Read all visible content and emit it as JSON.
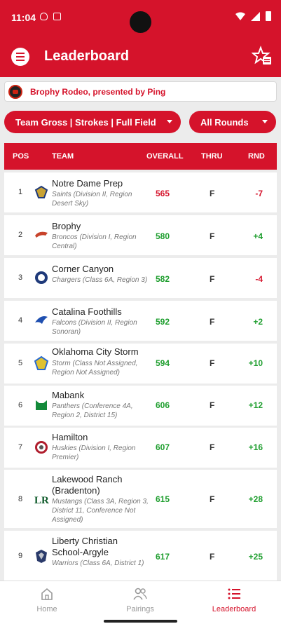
{
  "status": {
    "time": "11:04"
  },
  "app_bar": {
    "title": "Leaderboard"
  },
  "event": {
    "name": "Brophy Rodeo, presented by Ping"
  },
  "filters": {
    "main": "Team Gross | Strokes | Full Field",
    "rounds": "All Rounds"
  },
  "table": {
    "headers": {
      "pos": "POS",
      "team": "TEAM",
      "overall": "OVERALL",
      "thru": "THRU",
      "rnd": "RND"
    },
    "rows": [
      {
        "pos": "1",
        "name": "Notre Dame Prep",
        "sub": "Saints (Division II, Region Desert Sky)",
        "overall": "565",
        "thru": "F",
        "rnd": "-7",
        "overall_color": "#d5132b",
        "rnd_color": "#d5132b"
      },
      {
        "pos": "2",
        "name": "Brophy",
        "sub": "Broncos (Division I, Region Central)",
        "overall": "580",
        "thru": "F",
        "rnd": "+4",
        "overall_color": "#1e9e2e",
        "rnd_color": "#1e9e2e"
      },
      {
        "pos": "3",
        "name": "Corner Canyon",
        "sub": "Chargers (Class 6A, Region 3)",
        "overall": "582",
        "thru": "F",
        "rnd": "-4",
        "overall_color": "#1e9e2e",
        "rnd_color": "#d5132b"
      },
      {
        "pos": "4",
        "name": "Catalina Foothills",
        "sub": "Falcons (Division II, Region Sonoran)",
        "overall": "592",
        "thru": "F",
        "rnd": "+2",
        "overall_color": "#1e9e2e",
        "rnd_color": "#1e9e2e"
      },
      {
        "pos": "5",
        "name": "Oklahoma City Storm",
        "sub": "Storm (Class Not Assigned, Region Not Assigned)",
        "overall": "594",
        "thru": "F",
        "rnd": "+10",
        "overall_color": "#1e9e2e",
        "rnd_color": "#1e9e2e"
      },
      {
        "pos": "6",
        "name": "Mabank",
        "sub": "Panthers (Conference 4A, Region 2, District 15)",
        "overall": "606",
        "thru": "F",
        "rnd": "+12",
        "overall_color": "#1e9e2e",
        "rnd_color": "#1e9e2e"
      },
      {
        "pos": "7",
        "name": "Hamilton",
        "sub": "Huskies (Division I, Region Premier)",
        "overall": "607",
        "thru": "F",
        "rnd": "+16",
        "overall_color": "#1e9e2e",
        "rnd_color": "#1e9e2e"
      },
      {
        "pos": "8",
        "name": "Lakewood Ranch (Bradenton)",
        "sub": "Mustangs (Class 3A, Region 3, District 11, Conference Not Assigned)",
        "overall": "615",
        "thru": "F",
        "rnd": "+28",
        "overall_color": "#1e9e2e",
        "rnd_color": "#1e9e2e"
      },
      {
        "pos": "9",
        "name": "Liberty Christian School-Argyle",
        "sub": "Warriors (Class 6A, District 1)",
        "overall": "617",
        "thru": "F",
        "rnd": "+25",
        "overall_color": "#1e9e2e",
        "rnd_color": "#1e9e2e"
      }
    ]
  },
  "nav": {
    "home": "Home",
    "pairings": "Pairings",
    "leaderboard": "Leaderboard"
  }
}
